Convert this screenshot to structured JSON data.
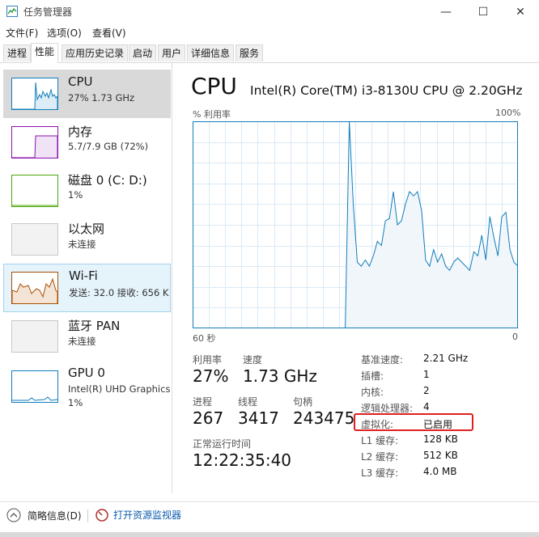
{
  "window": {
    "title": "任务管理器",
    "minimize_glyph": "—",
    "maximize_glyph": "☐",
    "close_glyph": "✕"
  },
  "menu": [
    "文件(F)",
    "选项(O)",
    "查看(V)"
  ],
  "tabs": [
    "进程",
    "性能",
    "应用历史记录",
    "启动",
    "用户",
    "详细信息",
    "服务"
  ],
  "sidebar": {
    "items": [
      {
        "name": "CPU",
        "sub1": "27% 1.73 GHz",
        "sub2": ""
      },
      {
        "name": "内存",
        "sub1": "5.7/7.9 GB (72%)",
        "sub2": ""
      },
      {
        "name": "磁盘 0 (C: D:)",
        "sub1": "1%",
        "sub2": ""
      },
      {
        "name": "以太网",
        "sub1": "未连接",
        "sub2": ""
      },
      {
        "name": "Wi-Fi",
        "sub1": "发送: 32.0  接收: 656 K",
        "sub2": ""
      },
      {
        "name": "蓝牙 PAN",
        "sub1": "未连接",
        "sub2": ""
      },
      {
        "name": "GPU 0",
        "sub1": "Intel(R) UHD Graphics",
        "sub2": "1%"
      }
    ]
  },
  "main": {
    "title": "CPU",
    "model": "Intel(R) Core(TM) i3-8130U CPU @ 2.20GHz",
    "graph_top_left": "% 利用率",
    "graph_top_right": "100%",
    "graph_bottom_left": "60 秒",
    "graph_bottom_right": "0",
    "stats": {
      "util_label": "利用率",
      "util_value": "27%",
      "speed_label": "速度",
      "speed_value": "1.73 GHz",
      "proc_label": "进程",
      "proc_value": "267",
      "thread_label": "线程",
      "thread_value": "3417",
      "handle_label": "句柄",
      "handle_value": "243475",
      "uptime_label": "正常运行时间",
      "uptime_value": "12:22:35:40"
    },
    "specs": [
      {
        "label": "基准速度:",
        "value": "2.21 GHz"
      },
      {
        "label": "插槽:",
        "value": "1"
      },
      {
        "label": "内核:",
        "value": "2"
      },
      {
        "label": "逻辑处理器:",
        "value": "4"
      },
      {
        "label": "虚拟化:",
        "value": "已启用"
      },
      {
        "label": "L1 缓存:",
        "value": "128 KB"
      },
      {
        "label": "L2 缓存:",
        "value": "512 KB"
      },
      {
        "label": "L3 缓存:",
        "value": "4.0 MB"
      }
    ]
  },
  "chart_data": {
    "type": "area",
    "ylim": [
      0,
      100
    ],
    "values": [
      0,
      0,
      0,
      0,
      0,
      0,
      0,
      0,
      0,
      0,
      0,
      0,
      0,
      0,
      0,
      0,
      0,
      0,
      0,
      0,
      0,
      0,
      0,
      0,
      0,
      0,
      0,
      0,
      0,
      0,
      0,
      0,
      0,
      0,
      0,
      0,
      0,
      0,
      0,
      100,
      60,
      32,
      30,
      33,
      30,
      35,
      42,
      40,
      52,
      53,
      66,
      50,
      52,
      60,
      66,
      64,
      66,
      57,
      33,
      30,
      38,
      32,
      36,
      30,
      28,
      32,
      34,
      32,
      30,
      28,
      37,
      35,
      45,
      33,
      54,
      44,
      35,
      54,
      56,
      38,
      32,
      30
    ]
  },
  "bottom": {
    "summary_label": "简略信息(D)",
    "monitor_label": "打开资源监视器"
  },
  "colors": {
    "cpu": "#117dbb",
    "memory": "#8b12ae",
    "disk": "#4da60c",
    "wifi": "#a74f01",
    "highlight": "#e02020"
  }
}
